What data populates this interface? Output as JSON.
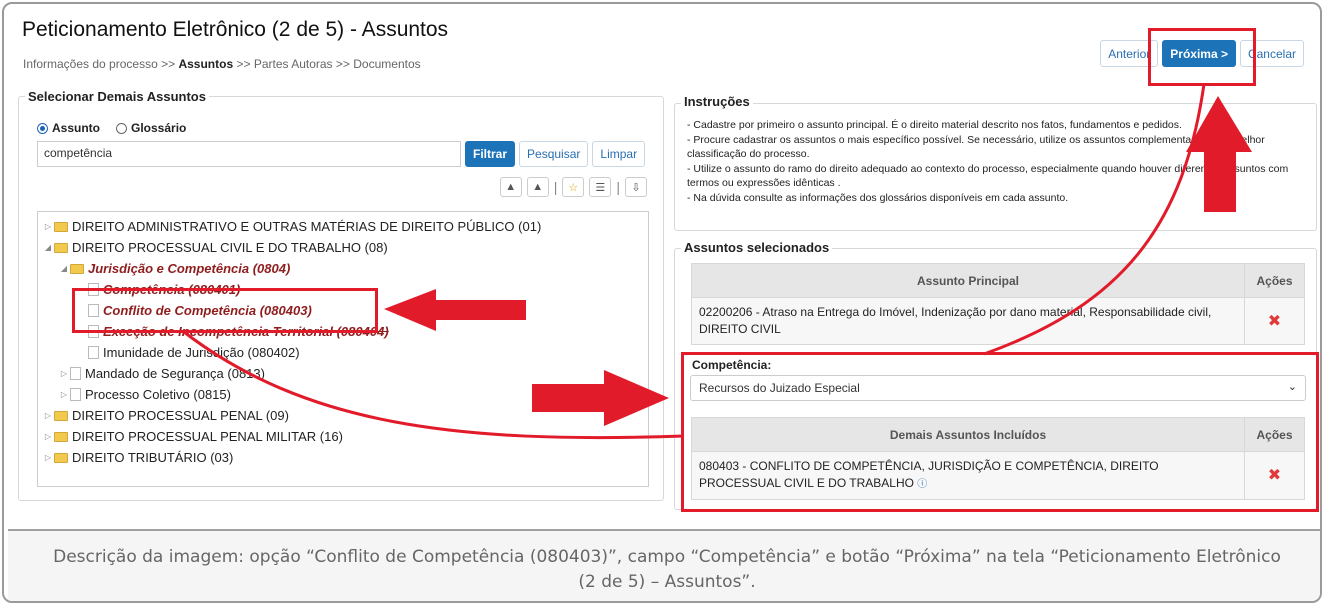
{
  "page": {
    "title": "Peticionamento Eletrônico (2 de 5) - Assuntos",
    "breadcrumb": [
      "Informações do processo",
      ">>",
      "Assuntos",
      ">>",
      "Partes Autoras",
      ">>",
      "Documentos"
    ]
  },
  "top_buttons": {
    "anterior": "Anterior",
    "proxima": "Próxima >",
    "cancelar": "Cancelar"
  },
  "left": {
    "legend": "Selecionar Demais Assuntos",
    "radio_assunto": "Assunto",
    "radio_glossario": "Glossário",
    "search_value": "competência",
    "filtrar": "Filtrar",
    "pesquisar": "Pesquisar",
    "limpar": "Limpar",
    "tree": [
      "DIREITO ADMINISTRATIVO E OUTRAS MATÉRIAS DE DIREITO PÚBLICO (01)",
      "DIREITO PROCESSUAL CIVIL E DO TRABALHO (08)",
      "Jurisdição e Competência (0804)",
      "Competência (080401)",
      "Conflito de Competência (080403)",
      "Exceção de Incompetência Territorial (080404)",
      "Imunidade de Jurisdição (080402)",
      "Mandado de Segurança (0813)",
      "Processo Coletivo (0815)",
      "DIREITO PROCESSUAL PENAL (09)",
      "DIREITO PROCESSUAL PENAL MILITAR (16)",
      "DIREITO TRIBUTÁRIO (03)"
    ]
  },
  "instructions": {
    "legend": "Instruções",
    "lines": [
      "- Cadastre por primeiro o assunto principal. É o direito material descrito nos fatos, fundamentos e pedidos.",
      "- Procure cadastrar os assuntos o mais específico possível. Se necessário, utilize os assuntos complementares para melhor classificação do processo.",
      "- Utilize o assunto do ramo do direito adequado ao contexto do processo, especialmente quando houver diferentes assuntos com termos ou expressões idênticas .",
      "- Na dúvida consulte as informações dos glossários disponíveis em cada assunto."
    ]
  },
  "selected": {
    "legend": "Assuntos selecionados",
    "principal_header": "Assunto Principal",
    "acoes": "Ações",
    "principal_text": "02200206 - Atraso na Entrega do Imóvel, Indenização por dano material, Responsabilidade civil, DIREITO CIVIL",
    "competencia_label": "Competência:",
    "competencia_value": "Recursos do Juizado Especial",
    "demais_header": "Demais Assuntos Incluídos",
    "demais_text": "080403 - CONFLITO DE COMPETÊNCIA, JURISDIÇÃO E COMPETÊNCIA, DIREITO PROCESSUAL CIVIL E DO TRABALHO"
  },
  "caption": "Descrição da imagem: opção “Conflito de Competência (080403)”, campo “Competência” e botão “Próxima” na tela “Peticionamento Eletrônico (2 de 5) – Assuntos”.",
  "colors": {
    "accent": "#1c73b8",
    "annotation_red": "#e21b2a",
    "dark_red_text": "#8f1d1d"
  }
}
